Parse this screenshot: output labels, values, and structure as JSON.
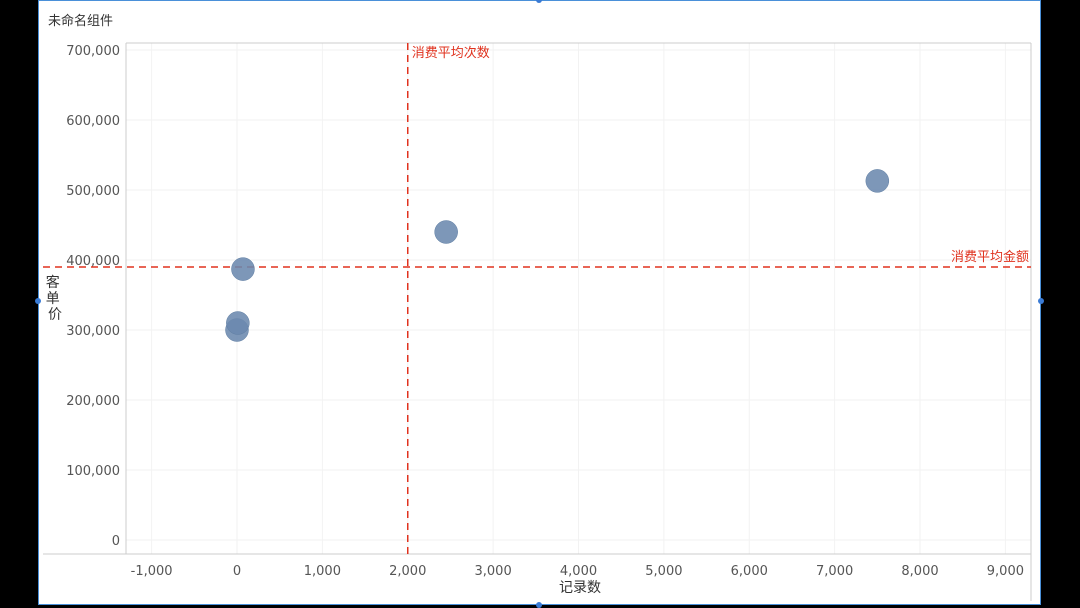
{
  "widget": {
    "title": "未命名组件"
  },
  "colors": {
    "point": "#6b89ae",
    "reference": "#e0321e",
    "axis": "#cccccc",
    "grid": "#f2f2f2",
    "text": "#555555"
  },
  "chart_data": {
    "type": "scatter",
    "title": "",
    "xlabel": "记录数",
    "ylabel": "客单价",
    "xlim": [
      -1300,
      9300
    ],
    "ylim": [
      -20000,
      710000
    ],
    "x_ticks": [
      -1000,
      0,
      1000,
      2000,
      3000,
      4000,
      5000,
      6000,
      7000,
      8000,
      9000
    ],
    "x_tick_labels": [
      "-1,000",
      "0",
      "1,000",
      "2,000",
      "3,000",
      "4,000",
      "5,000",
      "6,000",
      "7,000",
      "8,000",
      "9,000"
    ],
    "y_ticks": [
      0,
      100000,
      200000,
      300000,
      400000,
      500000,
      600000,
      700000
    ],
    "y_tick_labels": [
      "0",
      "100,000",
      "200,000",
      "300,000",
      "400,000",
      "500,000",
      "600,000",
      "700,000"
    ],
    "points": [
      {
        "x": 0,
        "y": 300000
      },
      {
        "x": 10,
        "y": 310000
      },
      {
        "x": 70,
        "y": 387000
      },
      {
        "x": 2450,
        "y": 440000
      },
      {
        "x": 7500,
        "y": 513000
      }
    ],
    "reference_lines": [
      {
        "axis": "x",
        "value": 2000,
        "label": "消费平均次数"
      },
      {
        "axis": "y",
        "value": 390000,
        "label": "消费平均金额"
      }
    ],
    "grid": true,
    "legend": "none"
  }
}
